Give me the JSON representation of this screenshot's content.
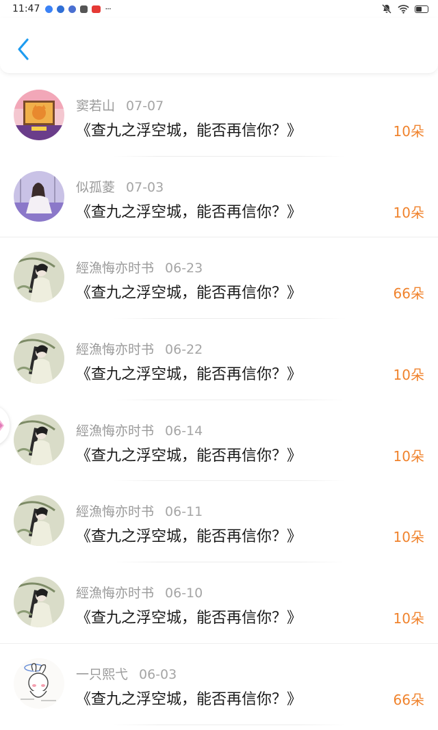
{
  "status_bar": {
    "time": "11:47",
    "more": "···"
  },
  "accent_color": "#1e9cf0",
  "amount_color": "#f0832d",
  "list": [
    {
      "name": "窦若山",
      "date": "07-07",
      "title": "《查九之浮空城，能否再信你？》",
      "amount": "10朵",
      "avatar": "cat-avatar"
    },
    {
      "name": "似孤菱",
      "date": "07-03",
      "title": "《查九之浮空城，能否再信你？》",
      "amount": "10朵",
      "avatar": "girl-lavender-avatar"
    },
    {
      "name": "經漁悔亦时书",
      "date": "06-23",
      "title": "《查九之浮空城，能否再信你？》",
      "amount": "66朵",
      "avatar": "umbrella-girl-avatar"
    },
    {
      "name": "經漁悔亦时书",
      "date": "06-22",
      "title": "《查九之浮空城，能否再信你？》",
      "amount": "10朵",
      "avatar": "umbrella-girl-avatar"
    },
    {
      "name": "經漁悔亦时书",
      "date": "06-14",
      "title": "《查九之浮空城，能否再信你？》",
      "amount": "10朵",
      "avatar": "umbrella-girl-avatar"
    },
    {
      "name": "經漁悔亦时书",
      "date": "06-11",
      "title": "《查九之浮空城，能否再信你？》",
      "amount": "10朵",
      "avatar": "umbrella-girl-avatar"
    },
    {
      "name": "經漁悔亦时书",
      "date": "06-10",
      "title": "《查九之浮空城，能否再信你？》",
      "amount": "10朵",
      "avatar": "umbrella-girl-avatar"
    },
    {
      "name": "一只熙弋",
      "date": "06-03",
      "title": "《查九之浮空城，能否再信你？》",
      "amount": "66朵",
      "avatar": "bunny-sketch-avatar"
    }
  ]
}
